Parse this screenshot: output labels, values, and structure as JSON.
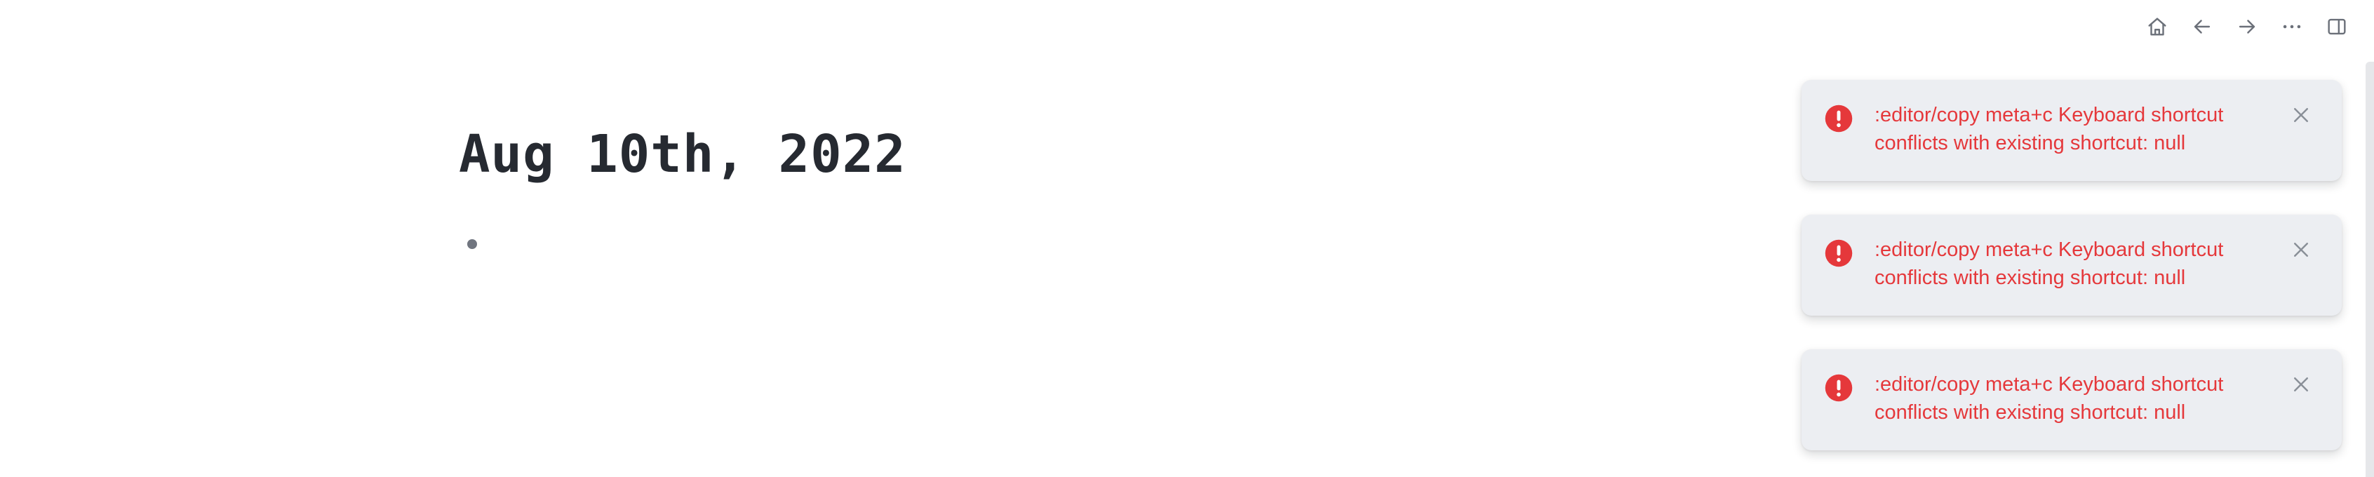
{
  "toolbar": {
    "items": [
      {
        "name": "home",
        "icon": "home-icon"
      },
      {
        "name": "back",
        "icon": "arrow-left-icon"
      },
      {
        "name": "forward",
        "icon": "arrow-right-icon"
      },
      {
        "name": "more",
        "icon": "more-horizontal-icon"
      },
      {
        "name": "toggle-right-sidebar",
        "icon": "sidebar-right-icon"
      }
    ],
    "icon_color": "#6b7079"
  },
  "journal": {
    "title": "Aug 10th, 2022",
    "blocks": [
      ""
    ]
  },
  "notifications": [
    {
      "icon": "error-circle-icon",
      "message": ":editor/copy meta+c Keyboard shortcut conflicts with existing shortcut: null"
    },
    {
      "icon": "error-circle-icon",
      "message": ":editor/copy meta+c Keyboard shortcut conflicts with existing shortcut: null"
    },
    {
      "icon": "error-circle-icon",
      "message": ":editor/copy meta+c Keyboard shortcut conflicts with existing shortcut: null"
    }
  ],
  "colors": {
    "error": "#e5383b",
    "notification_bg": "#eceef2",
    "title": "#262a31",
    "bullet": "#70757f",
    "close_icon": "#8a8f98"
  }
}
